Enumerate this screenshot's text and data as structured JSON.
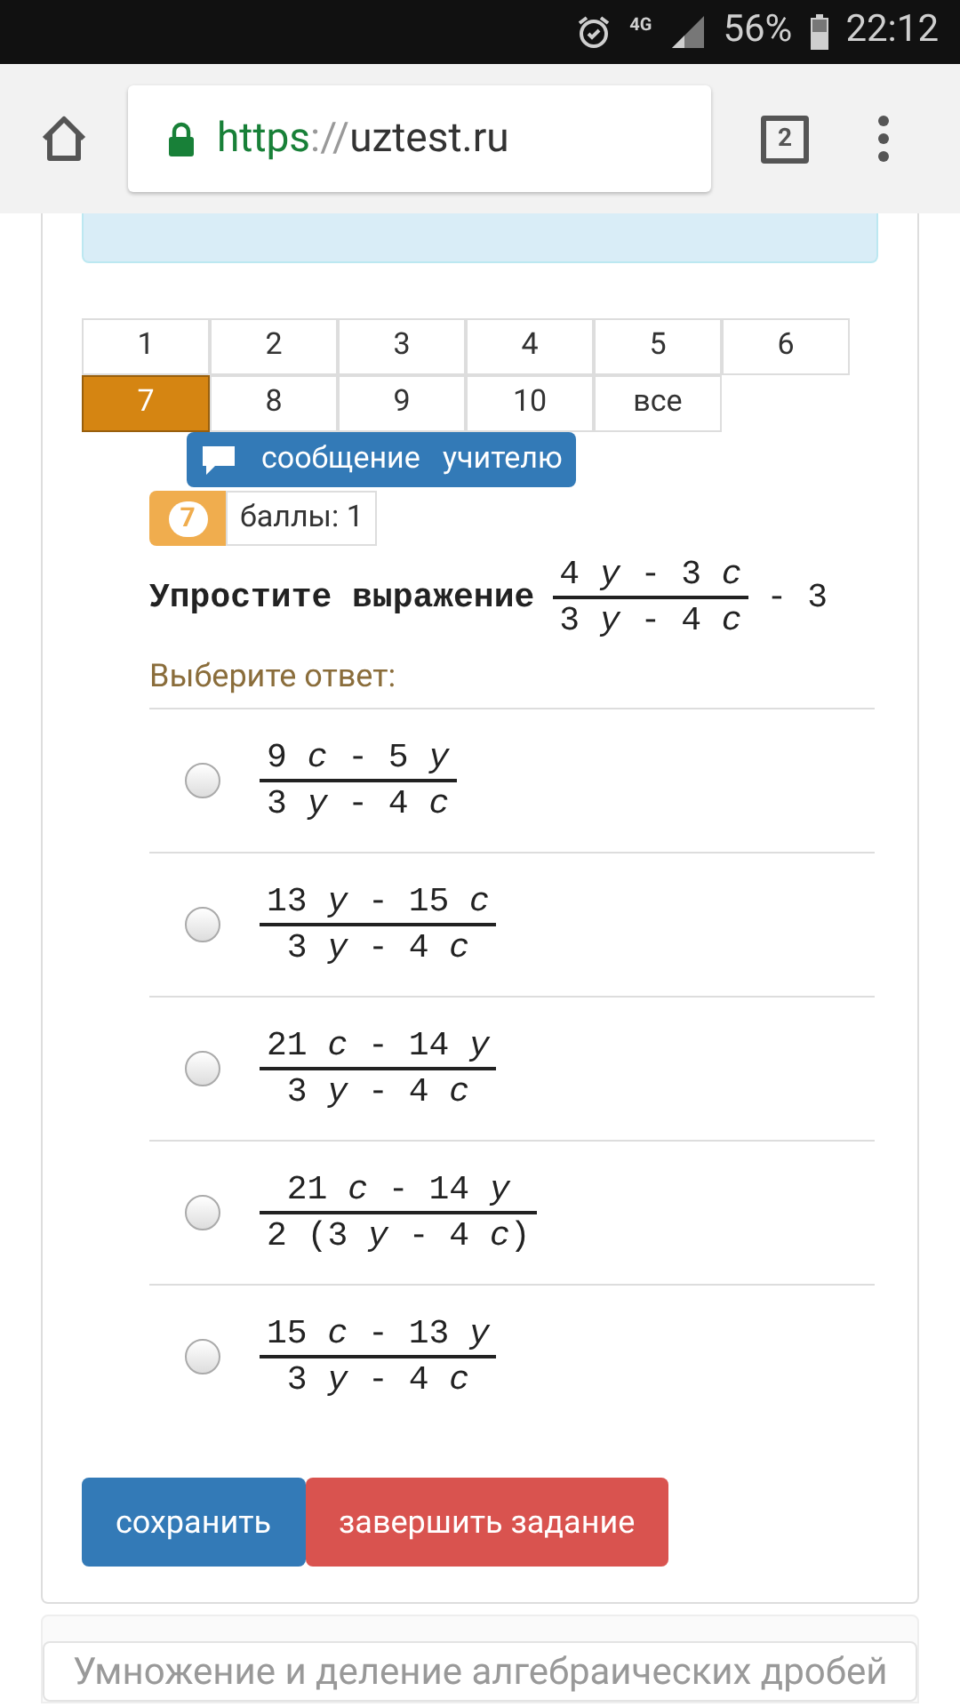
{
  "status_bar": {
    "network": "4G",
    "battery": "56%",
    "time": "22:12"
  },
  "browser": {
    "scheme": "https",
    "separator": "://",
    "host": "uztest.ru",
    "secure": true,
    "tab_count": "2"
  },
  "pagination": [
    {
      "label": "1",
      "selected": false
    },
    {
      "label": "2",
      "selected": false
    },
    {
      "label": "3",
      "selected": false
    },
    {
      "label": "4",
      "selected": false
    },
    {
      "label": "5",
      "selected": false
    },
    {
      "label": "6",
      "selected": false
    },
    {
      "label": "7",
      "selected": true
    },
    {
      "label": "8",
      "selected": false
    },
    {
      "label": "9",
      "selected": false
    },
    {
      "label": "10",
      "selected": false
    },
    {
      "label": "все",
      "selected": false
    }
  ],
  "message_button": "сообщение   учителю",
  "question_badge": {
    "number": "7",
    "points": "баллы: 1"
  },
  "question": {
    "text": "Упростите выражение",
    "numerator": "4 *y* - 3 *c*",
    "denominator": "3 *y* - 4 *c*",
    "tail": "- 3"
  },
  "answer_prompt": "Выберите ответ:",
  "options": [
    {
      "numerator": "9 *c* - 5 *y*",
      "denominator": "3 *y* - 4 *c*",
      "selected": false
    },
    {
      "numerator": "13 *y* - 15 *c*",
      "denominator": "3 *y* - 4 *c*",
      "selected": false
    },
    {
      "numerator": "21 *c* - 14 *y*",
      "denominator": "3 *y* - 4 *c*",
      "selected": false
    },
    {
      "numerator": "21 *c* - 14 *y*",
      "denominator": "2 (3 *y* - 4 *c*)",
      "selected": false
    },
    {
      "numerator": "15 *c* - 13 *y*",
      "denominator": "3 *y* - 4 *c*",
      "selected": false
    }
  ],
  "buttons": {
    "save": "сохранить",
    "finish": "завершить задание"
  },
  "next_topic": "Умножение и деление алгебраических дробей"
}
